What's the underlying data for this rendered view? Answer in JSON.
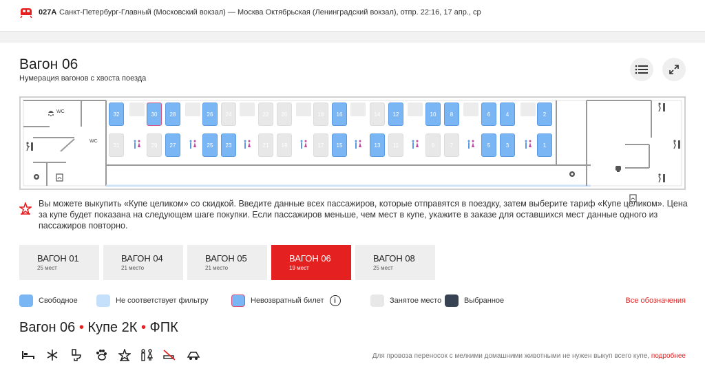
{
  "header": {
    "train_number": "027А",
    "route": "Санкт-Петербург-Главный (Московский вокзал) — Москва Октябрьская (Ленинградский вокзал),  отпр. 22:16, 17 апр., ср"
  },
  "car": {
    "title": "Вагон 06",
    "subtitle": "Нумерация вагонов с хвоста поезда",
    "wc_label": "WC",
    "upper_seats": [
      "32",
      "30",
      "28",
      "26",
      "24",
      "22",
      "20",
      "18",
      "16",
      "14",
      "12",
      "10",
      "8",
      "6",
      "4",
      "2"
    ],
    "lower_seats": [
      "31",
      "29",
      "27",
      "25",
      "23",
      "21",
      "19",
      "17",
      "15",
      "13",
      "11",
      "9",
      "7",
      "5",
      "3",
      "1"
    ],
    "free_seats": [
      "32",
      "28",
      "27",
      "26",
      "25",
      "23",
      "16",
      "15",
      "13",
      "12",
      "10",
      "8",
      "6",
      "5",
      "4",
      "3",
      "2",
      "1"
    ],
    "norefund_seats": [
      "30"
    ]
  },
  "notice": {
    "text": "Вы можете выкупить «Купе целиком» со скидкой. Введите данные всех пассажиров, которые отправятся в поездку, затем выберите тариф «Купе целиком». Цена за купе будет показана на следующем шаге покупки. Если пассажиров меньше, чем мест в купе, укажите в заказе для оставшихся мест данные одного из пассажиров повторно."
  },
  "wagons": [
    {
      "title": "ВАГОН 01",
      "seats": "25 мест",
      "active": false
    },
    {
      "title": "ВАГОН 04",
      "seats": "21 место",
      "active": false
    },
    {
      "title": "ВАГОН 05",
      "seats": "21 место",
      "active": false
    },
    {
      "title": "ВАГОН 06",
      "seats": "19 мест",
      "active": true
    },
    {
      "title": "ВАГОН 08",
      "seats": "25 мест",
      "active": false
    }
  ],
  "legend": {
    "items": [
      {
        "label": "Свободное",
        "color": "#7bb6f4"
      },
      {
        "label": "Не соответствует фильтру",
        "color": "#c4e0fb"
      },
      {
        "label": "Невозвратный билет",
        "color": "#7bb6f4"
      },
      {
        "label": "Занятое место",
        "color": "#e8e8e8"
      },
      {
        "label": "Выбранное",
        "color": "#374353"
      }
    ],
    "all_label": "Все обозначения"
  },
  "car_info": {
    "name": "Вагон 06",
    "class": "Купе 2К",
    "carrier": "ФПК",
    "separator": "•"
  },
  "amenities": [
    "bed-icon",
    "snowflake-icon",
    "toilet-icon",
    "paw-icon",
    "star-icon",
    "wc-icon",
    "no-smoking-icon",
    "transfer-icon"
  ],
  "pets": {
    "note": "Для провоза переносок с мелкими домашними животными не нужен выкуп всего купе,",
    "link": "подробнее"
  },
  "colors": {
    "accent": "#e52020",
    "free": "#7bb6f4",
    "occupied": "#e8e8e8",
    "selected": "#374353"
  }
}
